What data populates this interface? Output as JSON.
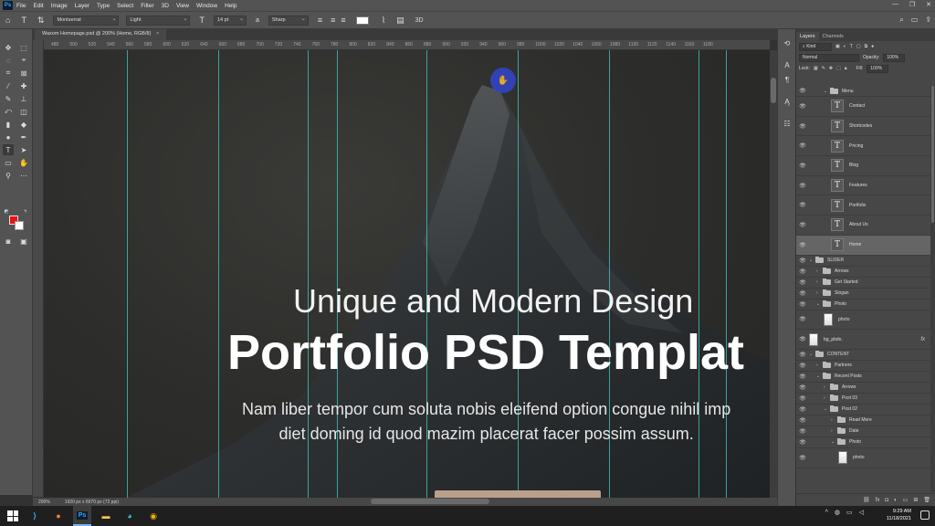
{
  "menu": {
    "logo": "Ps",
    "items": [
      "File",
      "Edit",
      "Image",
      "Layer",
      "Type",
      "Select",
      "Filter",
      "3D",
      "View",
      "Window",
      "Help"
    ]
  },
  "options_bar": {
    "font_family": "Montserrat",
    "font_style": "Light",
    "font_size": "14 pt",
    "aa_label": "a",
    "antialias": "Sharp",
    "threed_label": "3D"
  },
  "document": {
    "tab_title": "Waxom Homepage.psd @ 200% (Home, RGB/8)",
    "close_glyph": "×"
  },
  "ruler": {
    "ticks": [
      "480",
      "500",
      "520",
      "540",
      "560",
      "580",
      "600",
      "620",
      "640",
      "660",
      "680",
      "700",
      "720",
      "740",
      "760",
      "780",
      "800",
      "820",
      "840",
      "860",
      "880",
      "900",
      "920",
      "940",
      "960",
      "980",
      "1000",
      "1020",
      "1040",
      "1060",
      "1080",
      "1100",
      "1120",
      "1140",
      "1160",
      "1180"
    ]
  },
  "canvas": {
    "subtitle": "Unique and Modern Design",
    "title": "Portfolio PSD Templat",
    "body_line1": "Nam liber tempor cum soluta nobis eleifend option congue nihil imp",
    "body_line2": "diet doming id quod mazim placerat facer possim assum."
  },
  "status": {
    "zoom": "200%",
    "doc_size": "1920 px x 6970 px (72 ppi)"
  },
  "layers_panel": {
    "tabs": [
      "Layers",
      "Channels"
    ],
    "filter": "Kind",
    "blend_mode": "Normal",
    "opacity_label": "Opacity:",
    "opacity_value": "100%",
    "lock_label": "Lock:",
    "fill_label": "Fill:",
    "fill_value": "100%",
    "fx_label": "fx",
    "layers": [
      {
        "name": "Menu",
        "kind": "group",
        "indent": 2,
        "expanded": true
      },
      {
        "name": "Contact",
        "kind": "text",
        "indent": 3
      },
      {
        "name": "Shortcodes",
        "kind": "text",
        "indent": 3
      },
      {
        "name": "Pricing",
        "kind": "text",
        "indent": 3
      },
      {
        "name": "Blog",
        "kind": "text",
        "indent": 3
      },
      {
        "name": "Features",
        "kind": "text",
        "indent": 3
      },
      {
        "name": "Portfolio",
        "kind": "text",
        "indent": 3
      },
      {
        "name": "About Us",
        "kind": "text",
        "indent": 3
      },
      {
        "name": "Home",
        "kind": "text",
        "indent": 3,
        "selected": true
      },
      {
        "name": "SLIDER",
        "kind": "group",
        "indent": 0,
        "expanded": true
      },
      {
        "name": "Arrows",
        "kind": "group",
        "indent": 1
      },
      {
        "name": "Get Started",
        "kind": "group",
        "indent": 1
      },
      {
        "name": "Slogan",
        "kind": "group",
        "indent": 1
      },
      {
        "name": "Photo",
        "kind": "group",
        "indent": 1,
        "expanded": true
      },
      {
        "name": "photo",
        "kind": "image",
        "indent": 2
      },
      {
        "name": "bg_pbdo.",
        "kind": "image",
        "indent": 0,
        "fx": true
      },
      {
        "name": "CONTENT",
        "kind": "group",
        "indent": 0,
        "expanded": true
      },
      {
        "name": "Partners",
        "kind": "group",
        "indent": 1
      },
      {
        "name": "Recent Posts",
        "kind": "group",
        "indent": 1,
        "expanded": true
      },
      {
        "name": "Arrows",
        "kind": "group",
        "indent": 2
      },
      {
        "name": "Post 03",
        "kind": "group",
        "indent": 2
      },
      {
        "name": "Post 02",
        "kind": "group",
        "indent": 2,
        "expanded": true
      },
      {
        "name": "Read More",
        "kind": "group",
        "indent": 3
      },
      {
        "name": "Date",
        "kind": "group",
        "indent": 3
      },
      {
        "name": "Photo",
        "kind": "group",
        "indent": 3,
        "expanded": true
      },
      {
        "name": "photo",
        "kind": "image",
        "indent": 4
      }
    ]
  },
  "taskbar": {
    "time": "9:29 AM",
    "date": "11/18/2021",
    "apps": [
      "vscode",
      "firefox",
      "photoshop",
      "file-explorer",
      "edge",
      "chrome"
    ],
    "ps_label": "Ps"
  }
}
